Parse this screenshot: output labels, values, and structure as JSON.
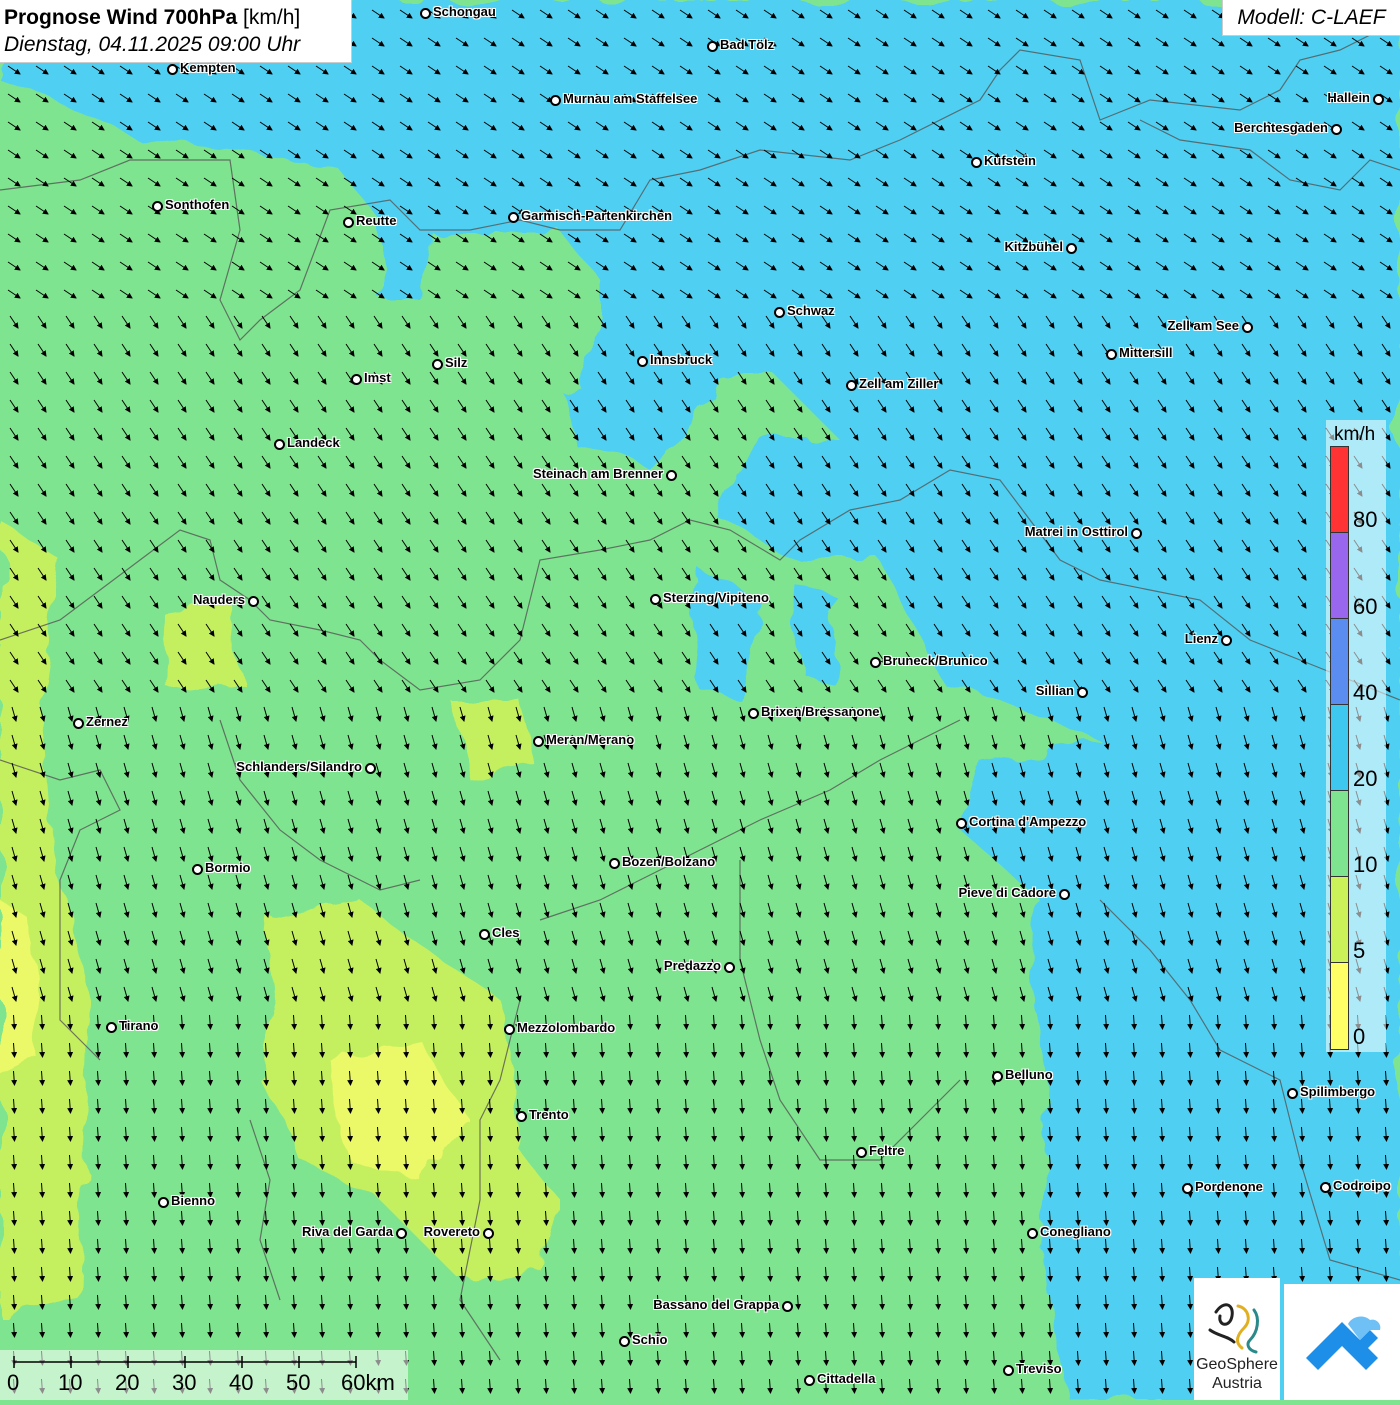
{
  "title": {
    "main": "Prognose Wind 700hPa",
    "unit": "[km/h]",
    "datetime": "Dienstag, 04.11.2025 09:00 Uhr"
  },
  "model": "Modell: C-LAEF",
  "colors": {
    "wind_0_5": "#ffff66",
    "wind_5_10": "#ccf25a",
    "wind_10_20": "#7fe48f",
    "wind_20_40": "#3ec8f0",
    "wind_40_60": "#5b8df0",
    "wind_60_80": "#9966ee",
    "wind_80_plus": "#ff3333"
  },
  "cities": [
    {
      "name": "Schongau"
    },
    {
      "name": "Bad Tölz"
    },
    {
      "name": "Kempten"
    },
    {
      "name": "Hallein"
    },
    {
      "name": "Murnau am Staffelsee"
    },
    {
      "name": "Berchtesgaden"
    },
    {
      "name": "Kufstein"
    },
    {
      "name": "Sonthofen"
    },
    {
      "name": "Reutte"
    },
    {
      "name": "Garmisch-Partenkirchen"
    },
    {
      "name": "Kitzbühel"
    },
    {
      "name": "Schwaz"
    },
    {
      "name": "Zell am See"
    },
    {
      "name": "Innsbruck"
    },
    {
      "name": "Mittersill"
    },
    {
      "name": "Silz"
    },
    {
      "name": "Imst"
    },
    {
      "name": "Zell am Ziller"
    },
    {
      "name": "Landeck"
    },
    {
      "name": "Steinach am Brenner"
    },
    {
      "name": "Matrei in Osttirol"
    },
    {
      "name": "Nauders"
    },
    {
      "name": "Sterzing/Vipiteno"
    },
    {
      "name": "Lienz"
    },
    {
      "name": "Bruneck/Brunico"
    },
    {
      "name": "Sillian"
    },
    {
      "name": "Zernez"
    },
    {
      "name": "Brixen/Bressanone"
    },
    {
      "name": "Meran/Merano"
    },
    {
      "name": "Schlanders/Silandro"
    },
    {
      "name": "Cortina d'Ampezzo"
    },
    {
      "name": "Bozen/Bolzano"
    },
    {
      "name": "Bormio"
    },
    {
      "name": "Pieve di Cadore"
    },
    {
      "name": "Cles"
    },
    {
      "name": "Predazzo"
    },
    {
      "name": "Tirano"
    },
    {
      "name": "Mezzolombardo"
    },
    {
      "name": "Belluno"
    },
    {
      "name": "Spilimbergo"
    },
    {
      "name": "Trento"
    },
    {
      "name": "Feltre"
    },
    {
      "name": "Pordenone"
    },
    {
      "name": "Codroipo"
    },
    {
      "name": "Bienno"
    },
    {
      "name": "Riva del Garda"
    },
    {
      "name": "Rovereto"
    },
    {
      "name": "Conegliano"
    },
    {
      "name": "Bassano del Grappa"
    },
    {
      "name": "Schio"
    },
    {
      "name": "Treviso"
    },
    {
      "name": "Cittadella"
    }
  ],
  "legend": {
    "unit": "km/h",
    "ticks": [
      "80",
      "60",
      "40",
      "20",
      "10",
      "5",
      "0"
    ]
  },
  "scalebar": {
    "ticks": [
      "0",
      "10",
      "20",
      "30",
      "40",
      "50",
      "60km"
    ]
  },
  "logo": {
    "name_line1": "GeoSphere",
    "name_line2": "Austria"
  }
}
